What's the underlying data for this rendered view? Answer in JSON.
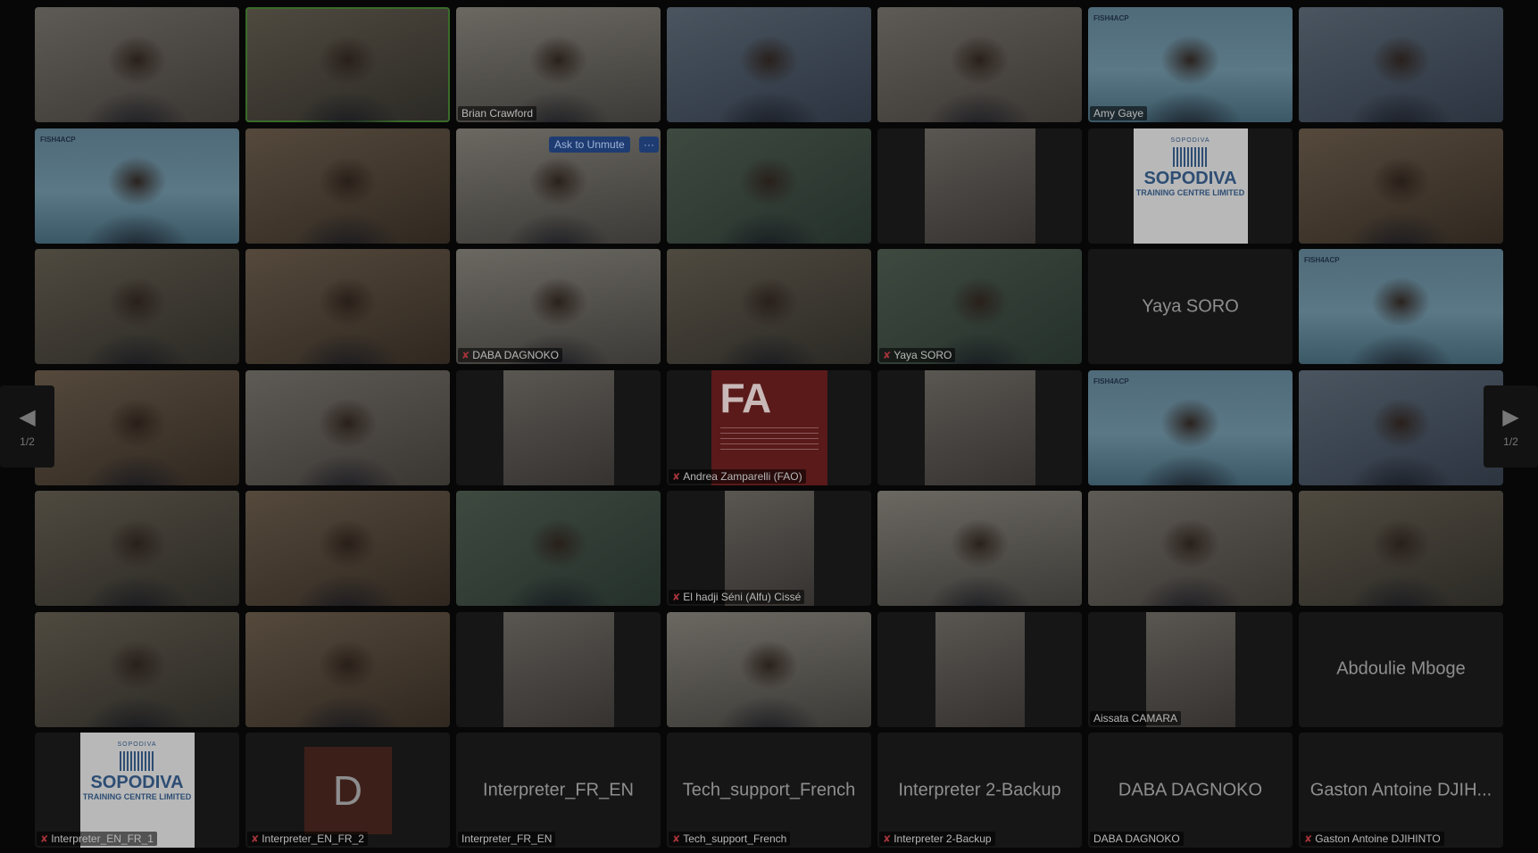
{
  "meeting": {
    "pager": {
      "prev_label": "1/2",
      "next_label": "1/2"
    },
    "ask_to_unmute_label": "Ask to Unmute",
    "more_label": "···",
    "banner_text": "FISH4ACP",
    "fao_logo_text": "FA",
    "sopodiva": {
      "top": "SOPODIVA",
      "name": "SOPODIVA",
      "sub": "TRAINING CENTRE LIMITED"
    },
    "avatar_letter": "D"
  },
  "tiles": [
    {
      "kind": "video",
      "bg": "bg-0",
      "name": "",
      "muted": false
    },
    {
      "kind": "video",
      "bg": "bg-1",
      "name": "",
      "muted": false,
      "active": true
    },
    {
      "kind": "video",
      "bg": "bg-2",
      "name": "Brian Crawford",
      "muted": false
    },
    {
      "kind": "video",
      "bg": "bg-3",
      "name": "",
      "muted": false
    },
    {
      "kind": "video",
      "bg": "bg-0",
      "name": "",
      "muted": false
    },
    {
      "kind": "banner",
      "name": "Amy Gaye",
      "muted": false
    },
    {
      "kind": "video",
      "bg": "bg-3",
      "name": "",
      "muted": false
    },
    {
      "kind": "banner",
      "name": "",
      "muted": false
    },
    {
      "kind": "video",
      "bg": "bg-5",
      "name": "",
      "muted": false
    },
    {
      "kind": "video",
      "bg": "bg-2",
      "name": "",
      "muted": false,
      "unmute_prompt": true
    },
    {
      "kind": "video",
      "bg": "bg-4",
      "name": "",
      "muted": false
    },
    {
      "kind": "inset",
      "name": "",
      "muted": false
    },
    {
      "kind": "sopodiva",
      "name": "",
      "muted": false
    },
    {
      "kind": "video",
      "bg": "bg-5",
      "name": "",
      "muted": false
    },
    {
      "kind": "video",
      "bg": "bg-1",
      "name": "",
      "muted": false
    },
    {
      "kind": "video",
      "bg": "bg-5",
      "name": "",
      "muted": false
    },
    {
      "kind": "video",
      "bg": "bg-2",
      "name": "DABA DAGNOKO",
      "muted": true
    },
    {
      "kind": "video",
      "bg": "bg-1",
      "name": "",
      "muted": false
    },
    {
      "kind": "video",
      "bg": "bg-4",
      "name": "Yaya SORO",
      "muted": true
    },
    {
      "kind": "text",
      "text": "Yaya SORO",
      "name": "",
      "muted": false
    },
    {
      "kind": "banner",
      "name": "",
      "muted": false
    },
    {
      "kind": "video",
      "bg": "bg-5",
      "name": "",
      "muted": false
    },
    {
      "kind": "video",
      "bg": "bg-0",
      "name": "",
      "muted": false
    },
    {
      "kind": "inset",
      "name": "",
      "muted": false
    },
    {
      "kind": "fao",
      "name": "Andrea Zamparelli (FAO)",
      "muted": true
    },
    {
      "kind": "inset",
      "name": "",
      "muted": false
    },
    {
      "kind": "banner",
      "name": "",
      "muted": false
    },
    {
      "kind": "video",
      "bg": "bg-3",
      "name": "",
      "muted": false
    },
    {
      "kind": "video",
      "bg": "bg-1",
      "name": "",
      "muted": false
    },
    {
      "kind": "video",
      "bg": "bg-5",
      "name": "",
      "muted": false
    },
    {
      "kind": "video",
      "bg": "bg-4",
      "name": "",
      "muted": false
    },
    {
      "kind": "inset-narrow",
      "name": "El hadji Séni (Alfu) Cissé",
      "muted": true
    },
    {
      "kind": "video",
      "bg": "bg-2",
      "name": "",
      "muted": false
    },
    {
      "kind": "video",
      "bg": "bg-0",
      "name": "",
      "muted": false
    },
    {
      "kind": "video",
      "bg": "bg-1",
      "name": "",
      "muted": false
    },
    {
      "kind": "video",
      "bg": "bg-1",
      "name": "",
      "muted": false
    },
    {
      "kind": "video",
      "bg": "bg-5",
      "name": "",
      "muted": false
    },
    {
      "kind": "inset",
      "name": "",
      "muted": false
    },
    {
      "kind": "video",
      "bg": "bg-2",
      "name": "",
      "muted": false
    },
    {
      "kind": "inset-narrow",
      "name": "",
      "muted": false
    },
    {
      "kind": "inset-narrow",
      "name": "Aissata CAMARA",
      "muted": false
    },
    {
      "kind": "text",
      "text": "Abdoulie Mboge",
      "name": "",
      "muted": false
    },
    {
      "kind": "sopodiva",
      "name": "Interpreter_EN_FR_1",
      "muted": true
    },
    {
      "kind": "avatar",
      "name": "Interpreter_EN_FR_2",
      "muted": true
    },
    {
      "kind": "text",
      "text": "Interpreter_FR_EN",
      "name": "Interpreter_FR_EN",
      "muted": false
    },
    {
      "kind": "text",
      "text": "Tech_support_French",
      "name": "Tech_support_French",
      "muted": true
    },
    {
      "kind": "text",
      "text": "Interpreter 2-Backup",
      "name": "Interpreter 2-Backup",
      "muted": true
    },
    {
      "kind": "text",
      "text": "DABA DAGNOKO",
      "name": "DABA DAGNOKO",
      "muted": false
    },
    {
      "kind": "text",
      "text": "Gaston Antoine DJIH...",
      "name": "Gaston Antoine DJIHINTO",
      "muted": true
    }
  ]
}
